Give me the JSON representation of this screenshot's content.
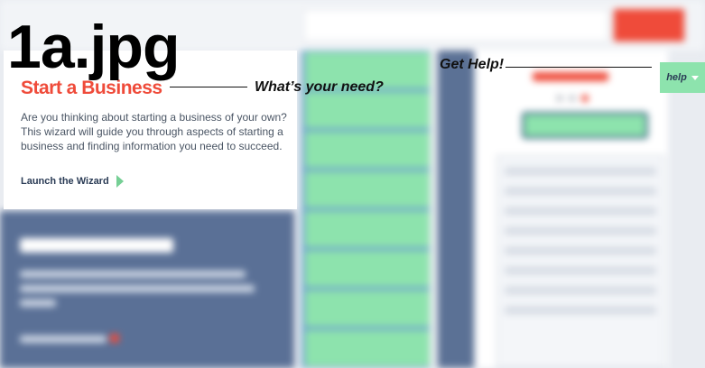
{
  "image_label": "1a.jpg",
  "annotations": {
    "whats_your_need": "What’s your need?",
    "get_help": "Get Help!"
  },
  "card": {
    "title": "Start a Business",
    "description": "Are you thinking about starting a business of your own? This wizard will guide you through aspects of starting a business and finding information you need to succeed.",
    "link_label": "Launch the Wizard",
    "link_icon": "play-triangle-icon"
  },
  "help_tab": {
    "label": "help",
    "icon": "chevron-down-icon"
  },
  "colors": {
    "accent_red": "#ef4b3a",
    "mint": "#8de3ad",
    "slate_blue": "#5a7096",
    "navy_text": "#2a3b55"
  }
}
